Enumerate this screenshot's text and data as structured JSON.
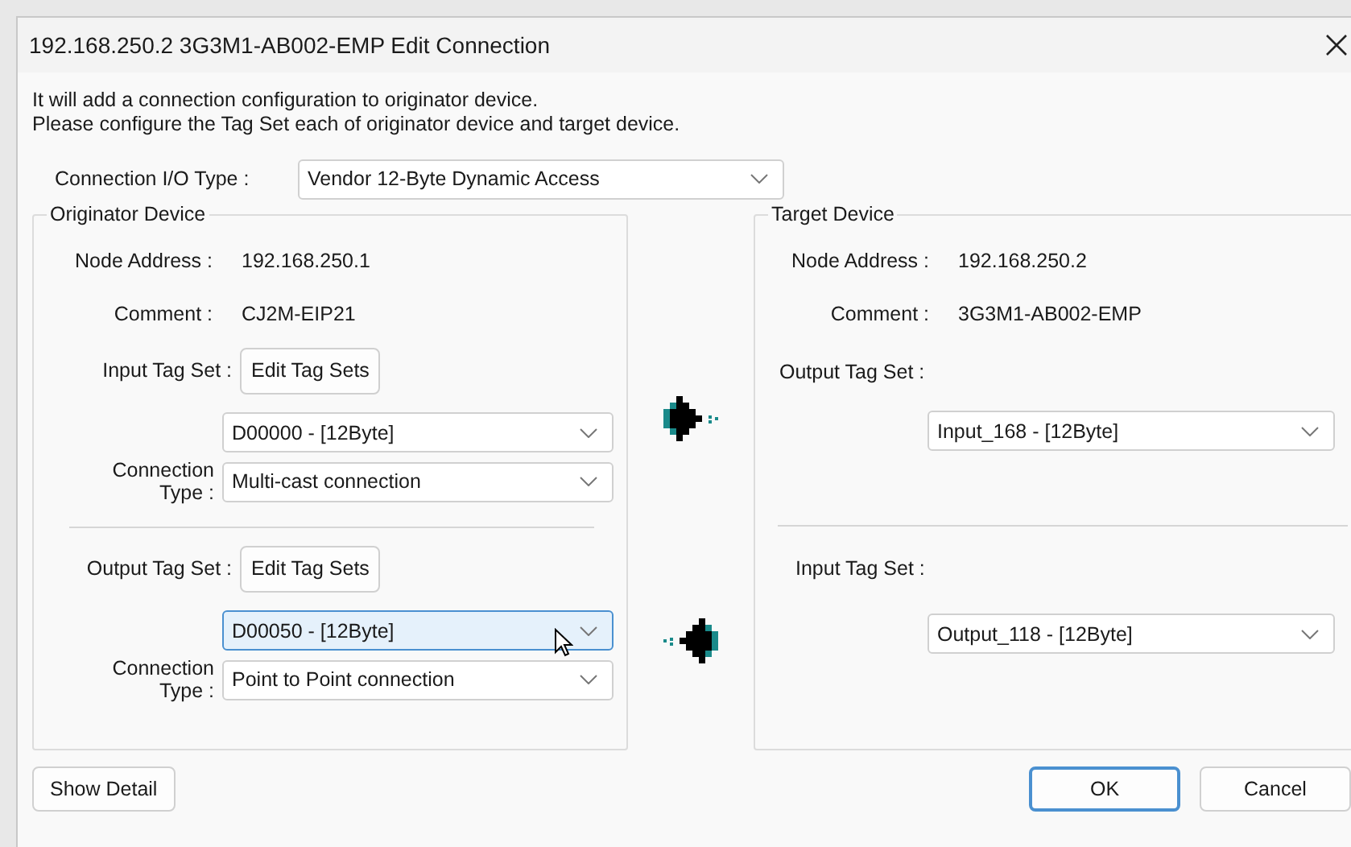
{
  "window": {
    "title": "192.168.250.2 3G3M1-AB002-EMP Edit Connection"
  },
  "description": [
    "It will add a connection configuration to originator device.",
    "Please configure the Tag Set each of originator device and target device."
  ],
  "io_type": {
    "label": "Connection I/O Type :",
    "value": "Vendor 12-Byte Dynamic Access"
  },
  "originator": {
    "title": "Originator Device",
    "node_label": "Node Address :",
    "node_value": "192.168.250.1",
    "comment_label": "Comment :",
    "comment_value": "CJ2M-EIP21",
    "sections": [
      {
        "tag_label": "Input Tag Set :",
        "button": "Edit Tag Sets",
        "tag_set": {
          "value": "D00000 - [12Byte]",
          "focused": false
        },
        "conn_label": "Connection Type :",
        "conn_type": {
          "value": "Multi-cast connection",
          "focused": false
        }
      },
      {
        "tag_label": "Output Tag Set :",
        "button": "Edit Tag Sets",
        "tag_set": {
          "value": "D00050 - [12Byte]",
          "focused": true
        },
        "conn_label": "Connection Type :",
        "conn_type": {
          "value": "Point to Point connection",
          "focused": false
        }
      }
    ]
  },
  "arrows": [
    {
      "kind": "outgoing"
    },
    {
      "kind": "incoming"
    }
  ],
  "target": {
    "title": "Target Device",
    "node_label": "Node Address :",
    "node_value": "192.168.250.2",
    "comment_label": "Comment :",
    "comment_value": "3G3M1-AB002-EMP",
    "sections": [
      {
        "tag_label": "Output Tag Set :",
        "tag_set": {
          "value": "Input_168 - [12Byte]",
          "focused": false
        }
      },
      {
        "tag_label": "Input Tag Set :",
        "tag_set": {
          "value": "Output_118 - [12Byte]",
          "focused": false
        }
      }
    ]
  },
  "footer": {
    "detail_button": "Show Detail",
    "buttons": [
      {
        "label": "OK",
        "default": true
      },
      {
        "label": "Cancel",
        "default": false
      }
    ]
  }
}
